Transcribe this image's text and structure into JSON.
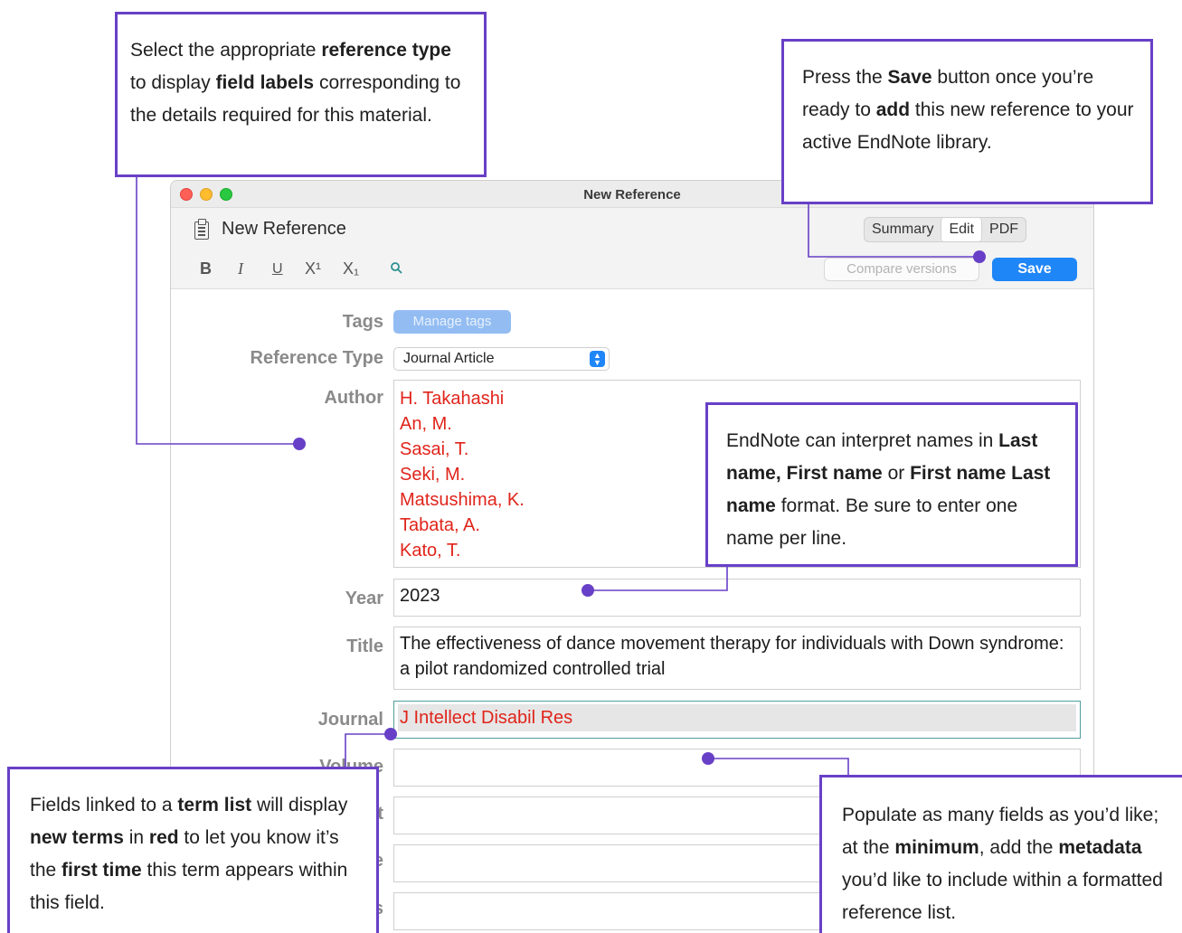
{
  "window": {
    "title": "New Reference",
    "header_title": "New Reference",
    "tabs": [
      {
        "label": "Summary",
        "active": false
      },
      {
        "label": "Edit",
        "active": true
      },
      {
        "label": "PDF",
        "active": false
      }
    ],
    "format_buttons": {
      "bold": "B",
      "italic": "I",
      "underline": "U",
      "superscript": "X¹",
      "subscript": "X₁"
    },
    "compare_label": "Compare versions",
    "save_label": "Save",
    "accent_color": "#1f86f7",
    "new_term_color": "#e0241b"
  },
  "form": {
    "tags_label": "Tags",
    "manage_tags_label": "Manage tags",
    "ref_type_label": "Reference Type",
    "ref_type_value": "Journal Article",
    "author_label": "Author",
    "authors": [
      "H. Takahashi",
      "An, M.",
      "Sasai, T.",
      "Seki, M.",
      "Matsushima, K.",
      "Tabata, A.",
      "Kato, T."
    ],
    "year_label": "Year",
    "year_value": "2023",
    "title_label": "Title",
    "title_value": "The effectiveness of dance movement therapy for individuals with Down syndrome: a pilot randomized controlled trial",
    "journal_label": "Journal",
    "journal_value": "J Intellect Disabil Res",
    "volume_label": "Volume",
    "partial_labels": [
      "t",
      "e",
      "s"
    ]
  },
  "callouts": {
    "ref_type": {
      "t1": "Select the appropriate ",
      "b1": "reference type",
      "t2": " to display ",
      "b2": "field labels",
      "t3": " corresponding to the details required for this material."
    },
    "save": {
      "t1": "Press the ",
      "b1": "Save",
      "t2": " button once you’re ready to ",
      "b2": "add",
      "t3": " this new reference to your active EndNote library."
    },
    "names": {
      "t1": "EndNote can interpret names in ",
      "b1": "Last name, First name",
      "t2": " or ",
      "b2": "First name Last name",
      "t3": " format. Be sure to enter one name per line."
    },
    "term_list": {
      "t1": "Fields linked to a ",
      "b1": "term list",
      "t2": " will display ",
      "b2": "new terms",
      "t3": " in ",
      "b3": "red",
      "t4": " to let you know it’s the ",
      "b4": "first time",
      "t5": " this term appears within this field."
    },
    "populate": {
      "t1": "Populate as many fields as you’d like; at the ",
      "b1": "minimum",
      "t2": ", add the ",
      "b2": "metadata",
      "t3": " you’d like to include within a formatted reference list."
    },
    "callout_color": "#6840c7"
  }
}
